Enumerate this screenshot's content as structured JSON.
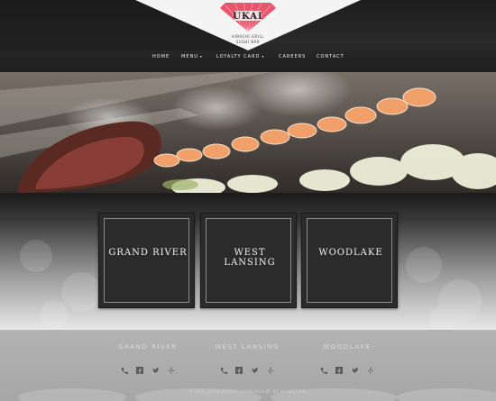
{
  "brand": {
    "name": "UKAI",
    "subtitle_1": "HIBACHI GRILL",
    "subtitle_2": "SUSHI BAR"
  },
  "nav": {
    "items": [
      {
        "label": "HOME"
      },
      {
        "label": "MENU",
        "has_dropdown": true
      },
      {
        "label": "LOYALTY CARD",
        "has_dropdown": true
      },
      {
        "label": "CAREERS"
      },
      {
        "label": "CONTACT"
      }
    ]
  },
  "locations": {
    "tiles": [
      {
        "label": "GRAND RIVER"
      },
      {
        "label": "WEST LANSING"
      },
      {
        "label": "WOODLAKE"
      }
    ]
  },
  "footer": {
    "locations": [
      {
        "name": "GRAND RIVER",
        "icons": [
          "phone-icon",
          "facebook-icon",
          "twitter-icon",
          "yelp-icon"
        ]
      },
      {
        "name": "WEST LANSING",
        "icons": [
          "phone-icon",
          "facebook-icon",
          "twitter-icon",
          "yelp-icon"
        ]
      },
      {
        "name": "WOODLAKE",
        "icons": [
          "phone-icon",
          "facebook-icon",
          "twitter-icon",
          "yelp-icon"
        ]
      }
    ],
    "copyright": "© UKAI JAPAN BISTRO | POWERED BY ME MARKETING"
  },
  "colors": {
    "accent_pink": "#e8556c",
    "header_bg": "#1f1f1f",
    "tile_bg": "#2b2b2b",
    "footer_bg": "#adadad"
  }
}
